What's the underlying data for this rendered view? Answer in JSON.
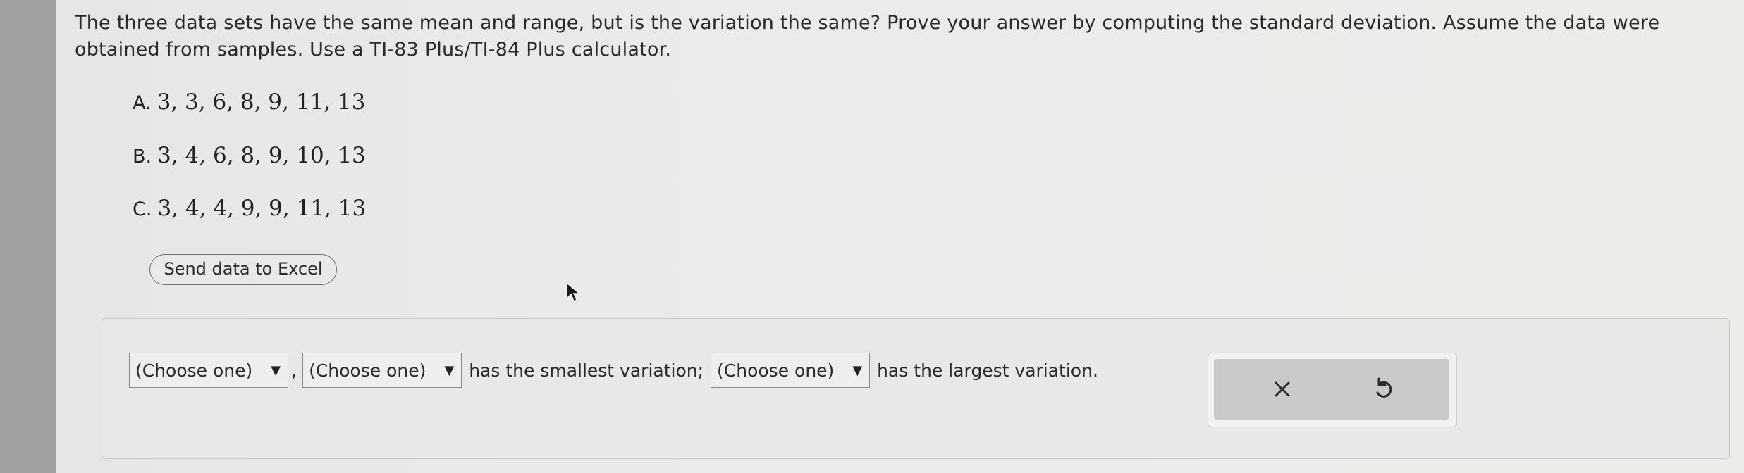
{
  "question": {
    "text": "The three data sets have the same mean and range, but is the variation the same? Prove your answer by computing the standard deviation. Assume the data were obtained from samples. Use a TI-83 Plus/TI-84 Plus calculator."
  },
  "datasets": [
    {
      "label": "A.",
      "values": "3, 3, 6, 8, 9, 11, 13"
    },
    {
      "label": "B.",
      "values": "3, 4, 6, 8, 9, 10, 13"
    },
    {
      "label": "C.",
      "values": "3, 4, 4, 9, 9, 11, 13"
    }
  ],
  "excel_button": {
    "label": "Send data to Excel"
  },
  "answer": {
    "select1": "(Choose one)",
    "separator": ",",
    "select2": "(Choose one)",
    "text_smallest": "has the smallest variation;",
    "select3": "(Choose one)",
    "text_largest": "has the largest variation."
  },
  "tools": {
    "clear_icon": "close-icon",
    "undo_icon": "undo-icon"
  },
  "colors": {
    "page_background": "#ebebea",
    "border": "#8a8a8a",
    "tool_panel": "#c9cac8"
  }
}
